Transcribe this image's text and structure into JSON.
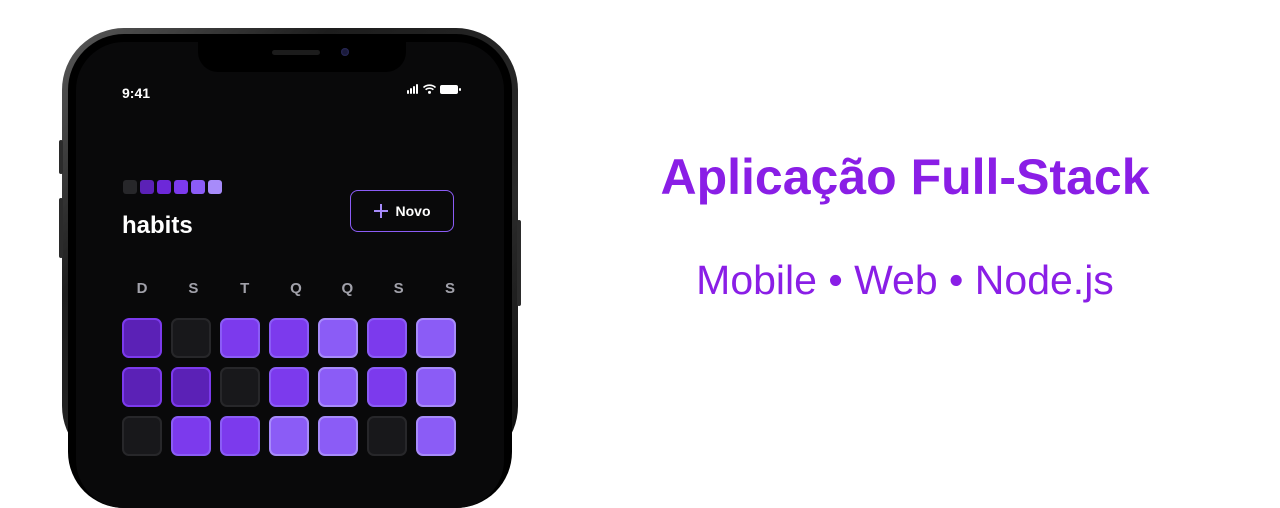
{
  "status": {
    "time": "9:41"
  },
  "app": {
    "title": "habits",
    "logo_colors": [
      "#27272a",
      "#4c1d95",
      "#5b21b6",
      "#6d28d9",
      "#7c3aed",
      "#8b5cf6",
      "#a78bfa"
    ],
    "new_button_label": "Novo",
    "accent": "#8b5cf6"
  },
  "weekdays": [
    "D",
    "S",
    "T",
    "Q",
    "Q",
    "S",
    "S"
  ],
  "habit_grid": {
    "rows": [
      [
        2,
        0,
        3,
        3,
        4,
        3,
        4
      ],
      [
        2,
        2,
        0,
        3,
        4,
        3,
        4
      ],
      [
        0,
        3,
        3,
        4,
        4,
        0,
        4
      ]
    ],
    "level_colors": {
      "0": {
        "bg": "#18181b",
        "border": "#27272a"
      },
      "1": {
        "bg": "#4c1d95",
        "border": "#6d28d9"
      },
      "2": {
        "bg": "#5b21b6",
        "border": "#7c3aed"
      },
      "3": {
        "bg": "#7c3aed",
        "border": "#8b5cf6"
      },
      "4": {
        "bg": "#8b5cf6",
        "border": "#a78bfa"
      }
    }
  },
  "hero": {
    "title": "Aplicação Full-Stack",
    "subtitle": "Mobile • Web • Node.js",
    "color": "#8a1ee6"
  }
}
